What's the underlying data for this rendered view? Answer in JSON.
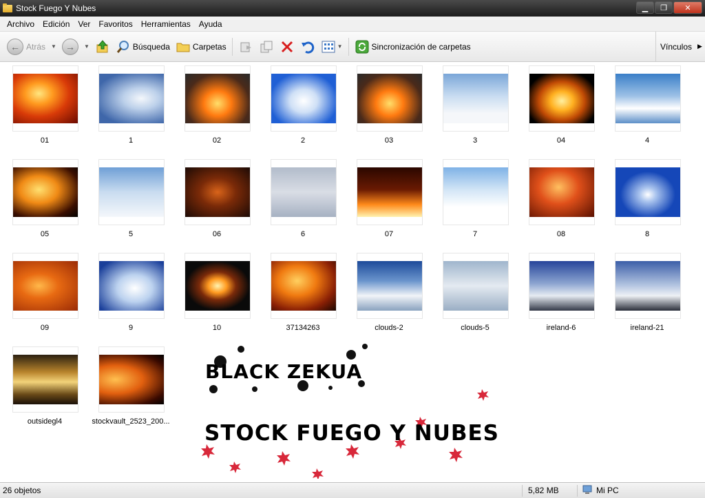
{
  "window": {
    "title": "Stock Fuego Y Nubes"
  },
  "menu": [
    "Archivo",
    "Edición",
    "Ver",
    "Favoritos",
    "Herramientas",
    "Ayuda"
  ],
  "toolbar": {
    "back_label": "Atrás",
    "search_label": "Búsqueda",
    "folders_label": "Carpetas",
    "sync_label": "Sincronización de carpetas",
    "links_label": "Vínculos"
  },
  "files": [
    {
      "name": "01",
      "icon": "fire-image"
    },
    {
      "name": "1",
      "icon": "sky-image"
    },
    {
      "name": "02",
      "icon": "fire-image"
    },
    {
      "name": "2",
      "icon": "sky-image"
    },
    {
      "name": "03",
      "icon": "fire-image"
    },
    {
      "name": "3",
      "icon": "sky-image"
    },
    {
      "name": "04",
      "icon": "fire-image"
    },
    {
      "name": "4",
      "icon": "sky-image"
    },
    {
      "name": "05",
      "icon": "fire-image"
    },
    {
      "name": "5",
      "icon": "sky-image"
    },
    {
      "name": "06",
      "icon": "fire-image"
    },
    {
      "name": "6",
      "icon": "sky-image"
    },
    {
      "name": "07",
      "icon": "fire-image"
    },
    {
      "name": "7",
      "icon": "sky-image"
    },
    {
      "name": "08",
      "icon": "fire-image"
    },
    {
      "name": "8",
      "icon": "sky-image"
    },
    {
      "name": "09",
      "icon": "fire-image"
    },
    {
      "name": "9",
      "icon": "sky-image"
    },
    {
      "name": "10",
      "icon": "explosion-image"
    },
    {
      "name": "37134263",
      "icon": "fire-image"
    },
    {
      "name": "clouds-2",
      "icon": "sky-image"
    },
    {
      "name": "clouds-5",
      "icon": "sky-image"
    },
    {
      "name": "ireland-6",
      "icon": "sky-image"
    },
    {
      "name": "ireland-21",
      "icon": "sky-image"
    },
    {
      "name": "outsidegl4",
      "icon": "sunset-image"
    },
    {
      "name": "stockvault_2523_200...",
      "icon": "fire-image"
    }
  ],
  "watermark": {
    "line1": "BLACK ZEKUA",
    "line2": "STOCK FUEGO Y NUBES"
  },
  "status": {
    "count": "26 objetos",
    "size": "5,82 MB",
    "location": "Mi PC"
  }
}
